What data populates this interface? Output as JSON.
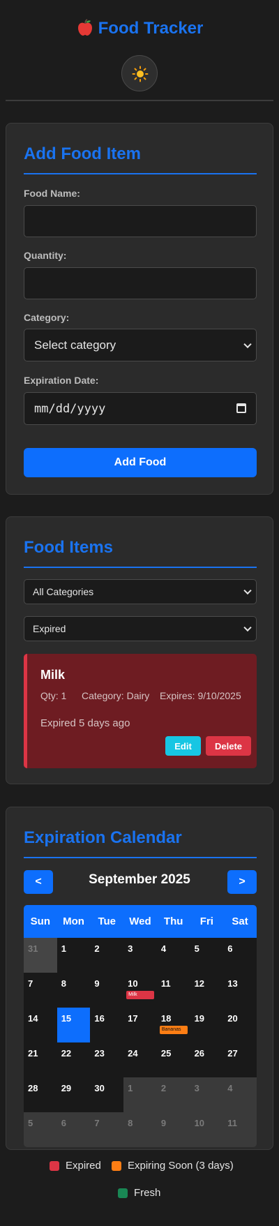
{
  "header": {
    "title": "Food Tracker",
    "theme_icon": "sun-icon"
  },
  "add_form": {
    "heading": "Add Food Item",
    "name_label": "Food Name:",
    "name_value": "",
    "quantity_label": "Quantity:",
    "quantity_value": "",
    "category_label": "Category:",
    "category_selected": "Select category",
    "date_label": "Expiration Date:",
    "date_placeholder": "mm/dd/yyyy",
    "submit_label": "Add Food"
  },
  "food_items": {
    "heading": "Food Items",
    "category_filter": "All Categories",
    "status_filter": "Expired",
    "items": [
      {
        "name": "Milk",
        "qty": "Qty: 1",
        "category": "Category: Dairy",
        "expires": "Expires: 9/10/2025",
        "status": "Expired 5 days ago",
        "edit_label": "Edit",
        "delete_label": "Delete"
      }
    ]
  },
  "calendar": {
    "heading": "Expiration Calendar",
    "prev_label": "<",
    "next_label": ">",
    "month_label": "September 2025",
    "weekdays": [
      "Sun",
      "Mon",
      "Tue",
      "Wed",
      "Thu",
      "Fri",
      "Sat"
    ],
    "days": [
      {
        "d": "31",
        "k": "prev"
      },
      {
        "d": "1",
        "k": "cur"
      },
      {
        "d": "2",
        "k": "cur"
      },
      {
        "d": "3",
        "k": "cur"
      },
      {
        "d": "4",
        "k": "cur"
      },
      {
        "d": "5",
        "k": "cur"
      },
      {
        "d": "6",
        "k": "cur"
      },
      {
        "d": "7",
        "k": "cur"
      },
      {
        "d": "8",
        "k": "cur"
      },
      {
        "d": "9",
        "k": "cur"
      },
      {
        "d": "10",
        "k": "cur",
        "tag": "Milk",
        "tag_status": "expired"
      },
      {
        "d": "11",
        "k": "cur"
      },
      {
        "d": "12",
        "k": "cur"
      },
      {
        "d": "13",
        "k": "cur"
      },
      {
        "d": "14",
        "k": "cur"
      },
      {
        "d": "15",
        "k": "today"
      },
      {
        "d": "16",
        "k": "cur"
      },
      {
        "d": "17",
        "k": "cur"
      },
      {
        "d": "18",
        "k": "cur",
        "tag": "Bananas",
        "tag_status": "expiring"
      },
      {
        "d": "19",
        "k": "cur"
      },
      {
        "d": "20",
        "k": "cur"
      },
      {
        "d": "21",
        "k": "cur"
      },
      {
        "d": "22",
        "k": "cur"
      },
      {
        "d": "23",
        "k": "cur"
      },
      {
        "d": "24",
        "k": "cur"
      },
      {
        "d": "25",
        "k": "cur"
      },
      {
        "d": "26",
        "k": "cur"
      },
      {
        "d": "27",
        "k": "cur"
      },
      {
        "d": "28",
        "k": "cur"
      },
      {
        "d": "29",
        "k": "cur"
      },
      {
        "d": "30",
        "k": "cur"
      },
      {
        "d": "1",
        "k": "next"
      },
      {
        "d": "2",
        "k": "next"
      },
      {
        "d": "3",
        "k": "next"
      },
      {
        "d": "4",
        "k": "next"
      },
      {
        "d": "5",
        "k": "next"
      },
      {
        "d": "6",
        "k": "next"
      },
      {
        "d": "7",
        "k": "next"
      },
      {
        "d": "8",
        "k": "next"
      },
      {
        "d": "9",
        "k": "next"
      },
      {
        "d": "10",
        "k": "next"
      },
      {
        "d": "11",
        "k": "next"
      }
    ],
    "legend": [
      {
        "label": "Expired",
        "color": "#dc3545"
      },
      {
        "label": "Expiring Soon (3 days)",
        "color": "#fd7e14"
      },
      {
        "label": "Fresh",
        "color": "#198754"
      }
    ]
  }
}
